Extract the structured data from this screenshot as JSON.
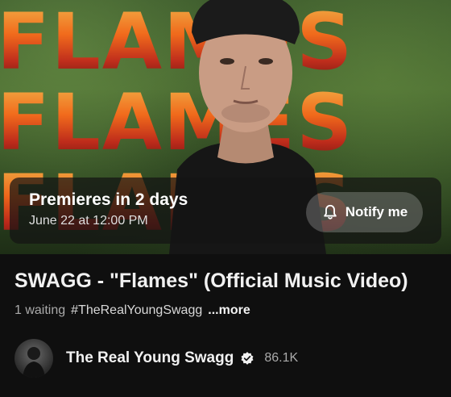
{
  "thumbnail": {
    "word_rows": [
      "FLAMES",
      "FLAMES",
      "FLAMES"
    ]
  },
  "premiere": {
    "title": "Premieres in 2 days",
    "date": "June 22 at 12:00 PM",
    "notify_label": "Notify me"
  },
  "video": {
    "title": "SWAGG - \"Flames\" (Official Music Video)",
    "waiting": "1 waiting",
    "hashtag": "#TheRealYoungSwagg",
    "more_label": "...more"
  },
  "channel": {
    "name": "The Real Young Swagg",
    "subscribers": "86.1K"
  },
  "colors": {
    "background": "#0f0f0f",
    "flame_orange": "#ff6a1a",
    "flame_red": "#c8271a"
  }
}
